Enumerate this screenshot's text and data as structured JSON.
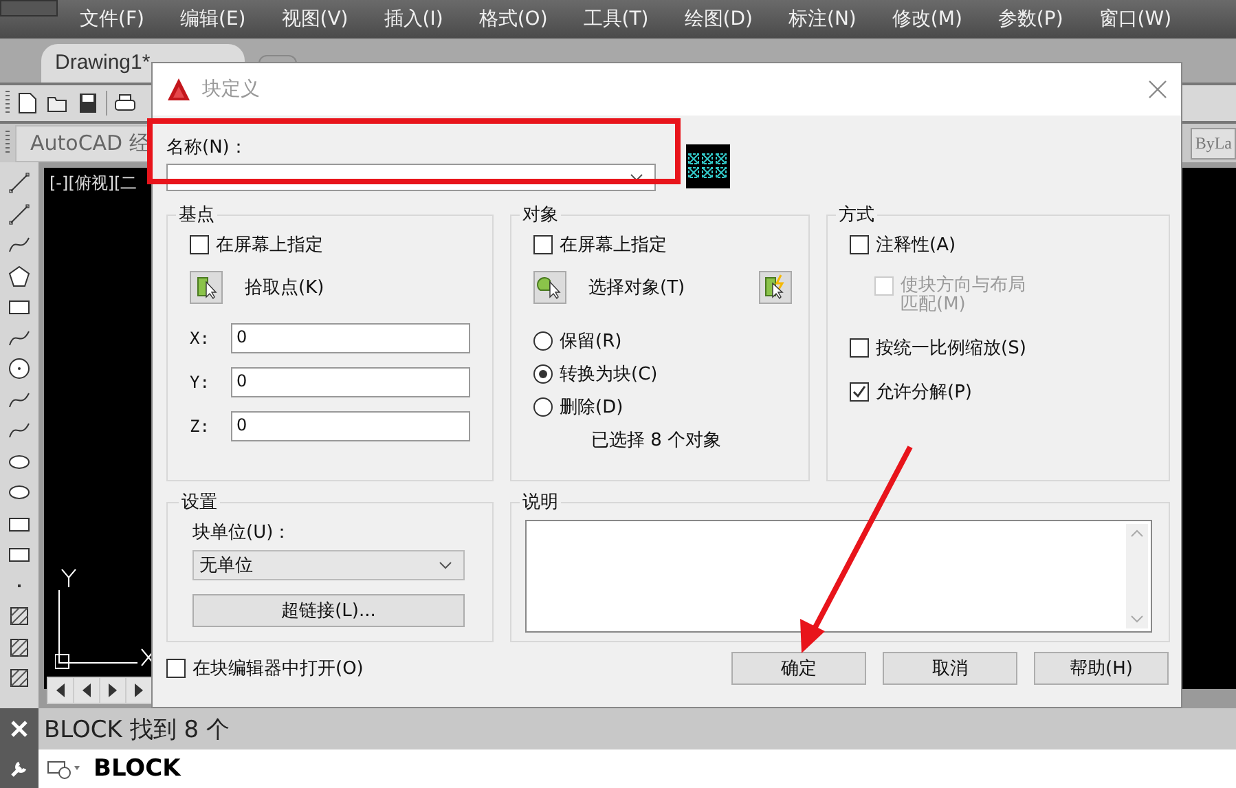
{
  "menu": [
    "文件(F)",
    "编辑(E)",
    "视图(V)",
    "插入(I)",
    "格式(O)",
    "工具(T)",
    "绘图(D)",
    "标注(N)",
    "修改(M)",
    "参数(P)",
    "窗口(W)"
  ],
  "tabs": [
    {
      "label": "Drawing1*",
      "selected": true
    }
  ],
  "workspace": "AutoCAD 经",
  "layer": "ByLa",
  "viewport_label": "[-][俯视][二",
  "dialog": {
    "title": "块定义",
    "name_label": "名称(N)：",
    "base_point": {
      "title": "基点",
      "specify": {
        "label": "在屏幕上指定",
        "checked": false
      },
      "pick_label": "拾取点(K)",
      "coords": [
        {
          "axis": "X:",
          "value": "0"
        },
        {
          "axis": "Y:",
          "value": "0"
        },
        {
          "axis": "Z:",
          "value": "0"
        }
      ]
    },
    "objects": {
      "title": "对象",
      "specify": {
        "label": "在屏幕上指定",
        "checked": false
      },
      "select_label": "选择对象(T)",
      "options": [
        {
          "label": "保留(R)",
          "selected": false
        },
        {
          "label": "转换为块(C)",
          "selected": true
        },
        {
          "label": "删除(D)",
          "selected": false
        }
      ],
      "count_text": "已选择 8 个对象"
    },
    "behavior": {
      "title": "方式",
      "options": [
        {
          "label": "注释性(A)",
          "checked": false,
          "disabled": false,
          "indented": false
        },
        {
          "label": "使块方向与布局匹配(M)",
          "checked": false,
          "disabled": true,
          "indented": true
        },
        {
          "label": "按统一比例缩放(S)",
          "checked": false,
          "disabled": false,
          "indented": false
        },
        {
          "label": "允许分解(P)",
          "checked": true,
          "disabled": false,
          "indented": false
        }
      ]
    },
    "settings": {
      "title": "设置",
      "unit_label": "块单位(U)：",
      "unit_value": "无单位",
      "hyperlink_button": "超链接(L)..."
    },
    "description": {
      "title": "说明"
    },
    "open_in_editor": {
      "label": "在块编辑器中打开(O)",
      "checked": false
    },
    "buttons": [
      "确定",
      "取消",
      "帮助(H)"
    ]
  },
  "command": {
    "history": "BLOCK 找到 8 个",
    "input": "BLOCK"
  }
}
